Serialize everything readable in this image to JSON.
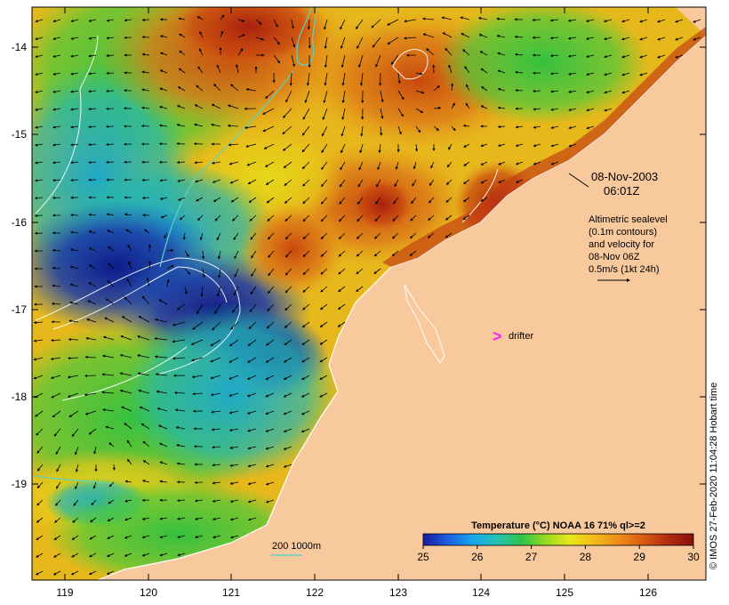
{
  "map": {
    "x_ticks": [
      "119",
      "120",
      "121",
      "122",
      "123",
      "124",
      "125",
      "126"
    ],
    "y_ticks": [
      "-14",
      "-15",
      "-16",
      "-17",
      "-18",
      "-19"
    ],
    "colors": {
      "land": "#f9c99e",
      "coast": "#ffffff",
      "arrow": "#000000",
      "contour": "#ffffff",
      "isobath": "#5ad3c6",
      "drifter": "#ff22ff"
    }
  },
  "annotations": {
    "date": "08-Nov-2003",
    "time": "06:01Z",
    "alt_line1": "Altimetric sealevel",
    "alt_line2": "(0.1m contours)",
    "alt_line3": "and velocity for",
    "alt_line4": "08-Nov 06Z",
    "alt_line5": "0.5m/s (1kt 24h)",
    "drifter_symbol": ">",
    "drifter_label": "drifter",
    "isobath_label": "200  1000m"
  },
  "colorbar": {
    "title": "Temperature (°C) NOAA 16 71% ql>=2",
    "ticks": [
      "25",
      "26",
      "27",
      "28",
      "29",
      "30"
    ],
    "min": 25,
    "max": 30,
    "colors": [
      "#1a1aa0",
      "#1f5fe0",
      "#19a6ee",
      "#26c2b4",
      "#2ec24a",
      "#98dc1e",
      "#e8e81a",
      "#f2b81a",
      "#ee8a18",
      "#d85a14",
      "#b02a10",
      "#8a0f0a"
    ]
  },
  "credit": "© IMOS 27-Feb-2020 11:04:28 Hobart time"
}
